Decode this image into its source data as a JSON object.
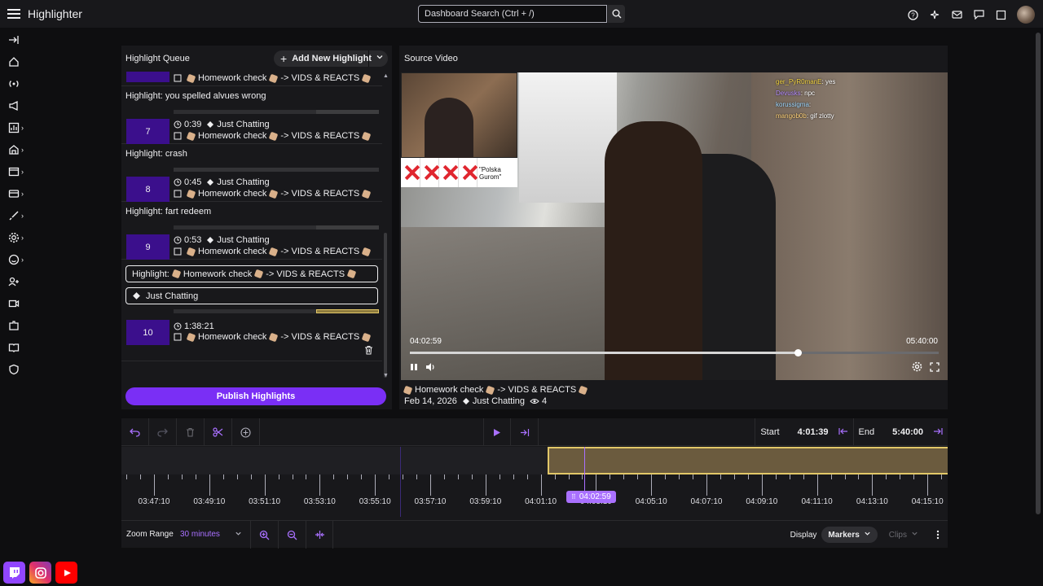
{
  "app": {
    "title": "Highlighter"
  },
  "search": {
    "placeholder": "Dashboard Search (Ctrl + /)"
  },
  "queue": {
    "title": "Highlight Queue",
    "add_label": "Add New Highlight",
    "publish_label": "Publish Highlights",
    "items": [
      {
        "title": "",
        "number": "",
        "duration": "",
        "category": "",
        "stream_title": "Homework check",
        "arrow_text": "-> VIDS & REACTS"
      },
      {
        "title": "Highlight: you spelled alvues wrong",
        "number": "7",
        "duration": "0:39",
        "category": "Just Chatting",
        "stream_title": "Homework check",
        "arrow_text": "-> VIDS & REACTS"
      },
      {
        "title": "Highlight: crash",
        "number": "8",
        "duration": "0:45",
        "category": "Just Chatting",
        "stream_title": "Homework check",
        "arrow_text": "-> VIDS & REACTS"
      },
      {
        "title": "Highlight: fart redeem",
        "number": "9",
        "duration": "0:53",
        "category": "Just Chatting",
        "stream_title": "Homework check",
        "arrow_text": "-> VIDS & REACTS"
      }
    ],
    "editing": {
      "title_prefix": "Highlight:",
      "title_stream": "Homework check",
      "title_arrow": "-> VIDS & REACTS",
      "category": "Just Chatting",
      "number": "10",
      "duration": "1:38:21",
      "stream_title": "Homework check",
      "arrow_text": "-> VIDS & REACTS"
    }
  },
  "source": {
    "title": "Source Video",
    "current_time": "04:02:59",
    "end_time": "05:40:00",
    "progress": 0.733,
    "stream_title": "Homework check",
    "arrow_text": "-> VIDS & REACTS",
    "date": "Feb 14, 2026",
    "category": "Just Chatting",
    "views": "4",
    "chat": [
      {
        "user": "ger_PyR0manE",
        "msg": "yes"
      },
      {
        "user": "Devusks",
        "msg": "npc"
      },
      {
        "user": "korussigma",
        "msg": ""
      },
      {
        "user": "mangob0b",
        "msg": "gif zlotty"
      }
    ],
    "poll_text": "\"Polska Gurom\""
  },
  "timeline": {
    "start_label": "Start",
    "start_value": "4:01:39",
    "end_label": "End",
    "end_value": "5:40:00",
    "playhead": "04:02:59",
    "ticks": [
      "03:47:10",
      "03:49:10",
      "03:51:10",
      "03:53:10",
      "03:55:10",
      "03:57:10",
      "03:59:10",
      "04:01:10",
      "04:03:10",
      "04:05:10",
      "04:07:10",
      "04:09:10",
      "04:11:10",
      "04:13:10",
      "04:15:10"
    ],
    "zoom_label": "Zoom Range",
    "zoom_value": "30 minutes",
    "display_label": "Display",
    "markers_label": "Markers",
    "clips_label": "Clips"
  },
  "colors": {
    "accent": "#7a2ff5",
    "selection": "#e2c768",
    "thumb": "#3b0f8c"
  }
}
